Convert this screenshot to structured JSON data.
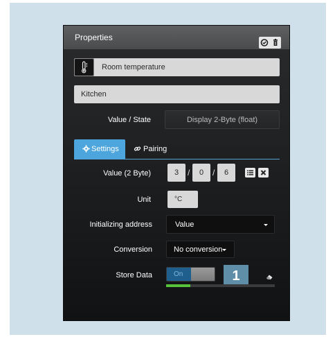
{
  "panel": {
    "title": "Properties",
    "icons": [
      "check-circle-icon",
      "trash-icon"
    ]
  },
  "object": {
    "icon": "thermometer-icon",
    "name": "Room temperature",
    "location": "Kitchen"
  },
  "value_state": {
    "label": "Value / State",
    "button": "Display 2-Byte (float)"
  },
  "tabs": [
    {
      "label": "Settings",
      "icon": "gear-icon",
      "active": true
    },
    {
      "label": "Pairing",
      "icon": "link-icon",
      "active": false
    }
  ],
  "settings": {
    "value_label": "Value (2 Byte)",
    "address": [
      "3",
      "0",
      "6"
    ],
    "address_separator": "/",
    "unit_label": "Unit",
    "unit_value": "°C",
    "init_label": "Initializing address",
    "init_value": "Value",
    "conversion_label": "Conversion",
    "conversion_value": "No conversion",
    "store_label": "Store Data",
    "store_toggle": "On",
    "callout_number": "1",
    "progress_fraction": 0.22
  },
  "colors": {
    "accent": "#4da5dd",
    "toggle_on": "#1f5f8e",
    "progress": "#58c23a",
    "callout": "#5f8fa8",
    "background": "#cfe0ea"
  }
}
